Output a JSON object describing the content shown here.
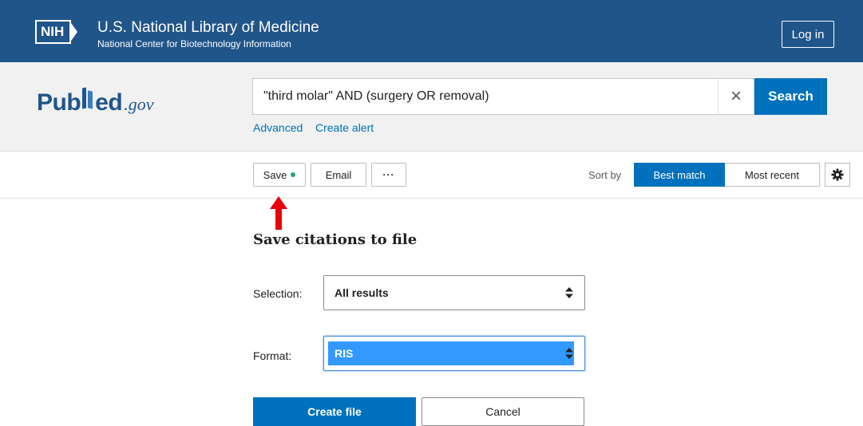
{
  "header": {
    "nih_logo": "NIH",
    "title": "U.S. National Library of Medicine",
    "subtitle": "National Center for Biotechnology Information",
    "login_label": "Log in"
  },
  "search": {
    "logo_pub": "Pub",
    "logo_med": "ed",
    "logo_gov": ".gov",
    "query": "\"third molar\" AND (surgery OR removal)",
    "clear_icon": "×",
    "button_label": "Search",
    "advanced_label": "Advanced",
    "alert_label": "Create alert"
  },
  "toolbar": {
    "save_label": "Save",
    "email_label": "Email",
    "more_label": "···",
    "sort_by_label": "Sort by",
    "best_match_label": "Best match",
    "most_recent_label": "Most recent"
  },
  "save_panel": {
    "title": "Save citations to file",
    "selection_label": "Selection:",
    "selection_value": "All results",
    "format_label": "Format:",
    "format_value": "RIS",
    "create_label": "Create file",
    "cancel_label": "Cancel"
  },
  "colors": {
    "header_bg": "#20558a",
    "accent": "#0071bc",
    "annotation_arrow": "#e8000b"
  }
}
